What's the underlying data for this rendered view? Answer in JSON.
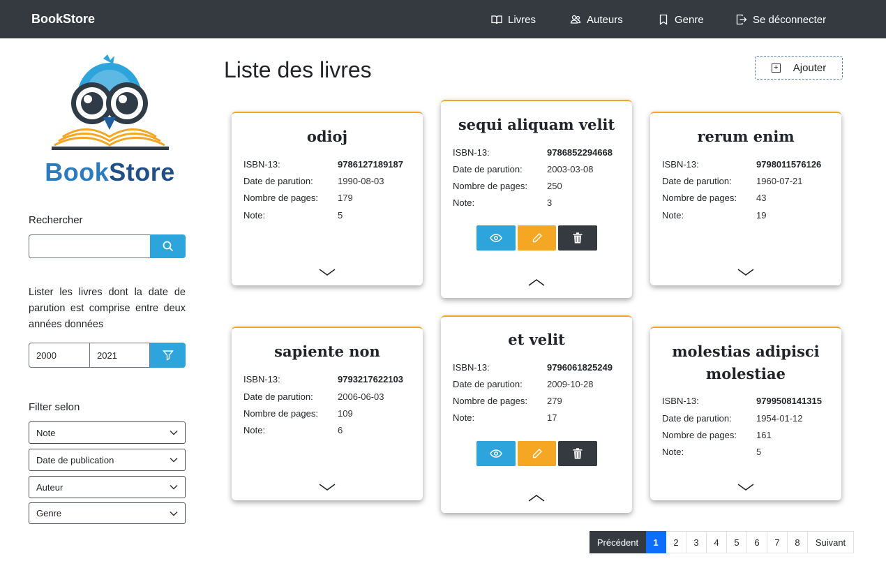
{
  "navbar": {
    "brand": "BookStore",
    "items": [
      {
        "label": "Livres",
        "icon": "book-open-icon"
      },
      {
        "label": "Auteurs",
        "icon": "users-icon"
      },
      {
        "label": "Genre",
        "icon": "bookmark-icon"
      },
      {
        "label": "Se déconnecter",
        "icon": "logout-icon"
      }
    ]
  },
  "sidebar": {
    "logo_text": {
      "part1": "Book",
      "part2": "Store"
    },
    "search_label": "Rechercher",
    "search_value": "",
    "range_description": "Lister les livres dont la date de parution est comprise entre deux années données",
    "year_from": "2000",
    "year_to": "2021",
    "filter_label": "Filter selon",
    "filters": [
      "Note",
      "Date de publication",
      "Auteur",
      "Genre"
    ]
  },
  "main": {
    "title": "Liste des livres",
    "add_label": "Ajouter",
    "field_labels": {
      "isbn": "ISBN-13:",
      "date": "Date de parution:",
      "pages": "Nombre de pages:",
      "note": "Note:"
    },
    "books": [
      {
        "title": "odioj",
        "isbn": "9786127189187",
        "date": "1990-08-03",
        "pages": "179",
        "note": "5"
      },
      {
        "title": "sequi aliquam velit",
        "isbn": "9786852294668",
        "date": "2003-03-08",
        "pages": "250",
        "note": "3"
      },
      {
        "title": "rerum enim",
        "isbn": "9798011576126",
        "date": "1960-07-21",
        "pages": "43",
        "note": "19"
      },
      {
        "title": "sapiente non",
        "isbn": "9793217622103",
        "date": "2006-06-03",
        "pages": "109",
        "note": "6"
      },
      {
        "title": "et velit",
        "isbn": "9796061825249",
        "date": "2009-10-28",
        "pages": "279",
        "note": "17"
      },
      {
        "title": "molestias adipisci molestiae",
        "isbn": "9799508141315",
        "date": "1954-01-12",
        "pages": "161",
        "note": "5"
      }
    ]
  },
  "pagination": {
    "prev": "Précédent",
    "pages": [
      "1",
      "2",
      "3",
      "4",
      "5",
      "6",
      "7",
      "8"
    ],
    "active": "1",
    "next": "Suivant"
  },
  "colors": {
    "navbar": "#343a40",
    "accent_blue": "#2ea4dc",
    "accent_orange": "#f5a623",
    "active_page": "#0d6efd"
  }
}
